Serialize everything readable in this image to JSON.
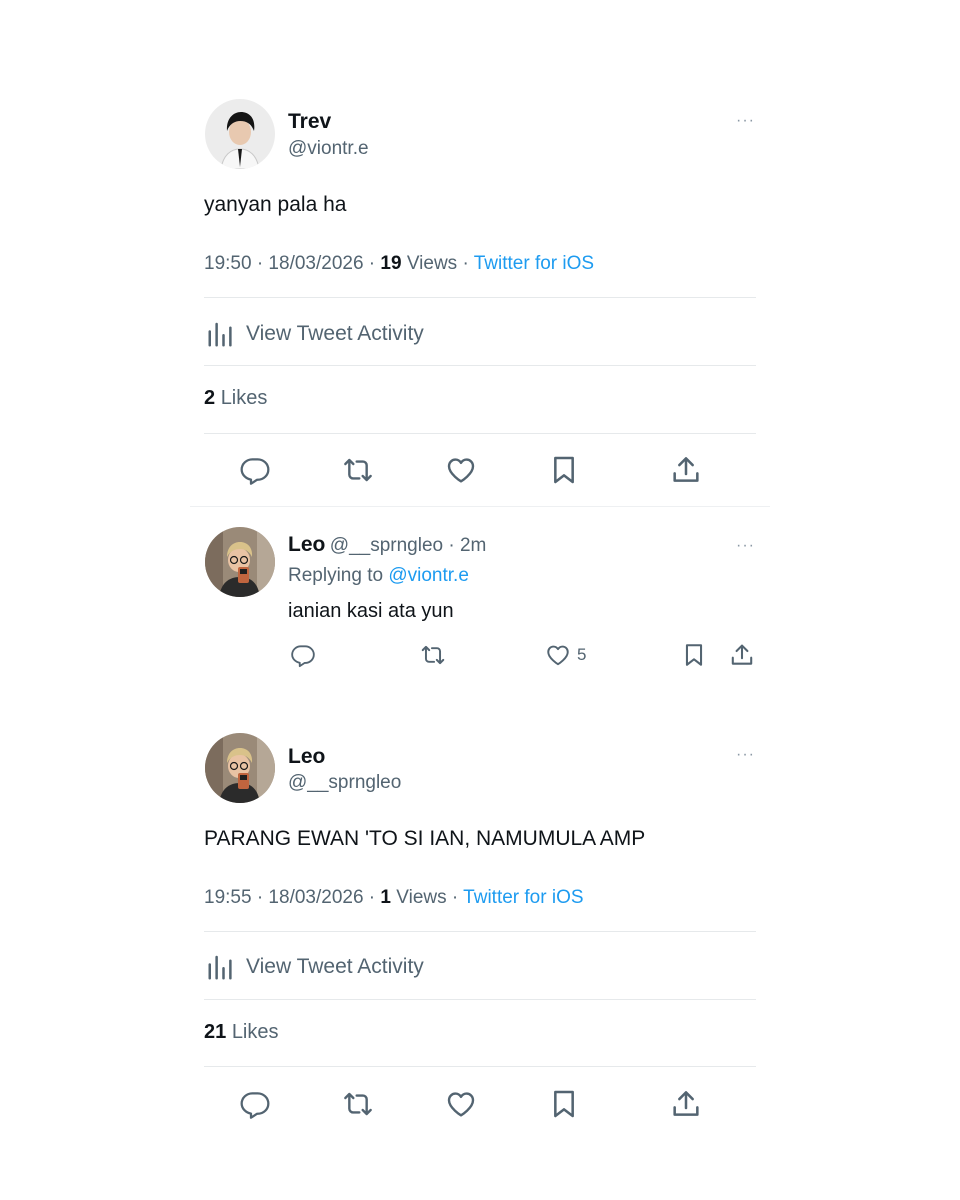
{
  "tweet1": {
    "name": "Trev",
    "handle": "@viontr.e",
    "text": "yanyan pala ha",
    "time": "19:50 · 18/03/2026 · ",
    "views_count": "19",
    "views_label": "Views",
    "sep": " · ",
    "source": "Twitter for iOS",
    "activity_label": "View Tweet Activity",
    "likes_count": "2",
    "likes_label": "Likes",
    "more": "···"
  },
  "reply": {
    "name": "Leo",
    "handle": "@__sprngleo",
    "age": " · 2m",
    "replying_label": "Replying to ",
    "replying_to": "@viontr.e",
    "text": "ianian kasi ata yun",
    "like_count": "5",
    "more": "···"
  },
  "tweet2": {
    "name": "Leo",
    "handle": "@__sprngleo",
    "text": "PARANG EWAN 'TO SI IAN, NAMUMULA AMP",
    "time": "19:55 · 18/03/2026 · ",
    "views_count": "1",
    "views_label": "Views",
    "sep": " · ",
    "source": "Twitter for iOS",
    "activity_label": "View Tweet Activity",
    "likes_count": "21",
    "likes_label": "Likes",
    "more": "···"
  },
  "colors": {
    "link": "#1d9bf0",
    "secondary": "#536471",
    "primary": "#0f1419",
    "icon": "#536471"
  },
  "icons": [
    "reply-icon",
    "retweet-icon",
    "like-icon",
    "bookmark-icon",
    "share-icon",
    "analytics-icon",
    "more-icon"
  ]
}
